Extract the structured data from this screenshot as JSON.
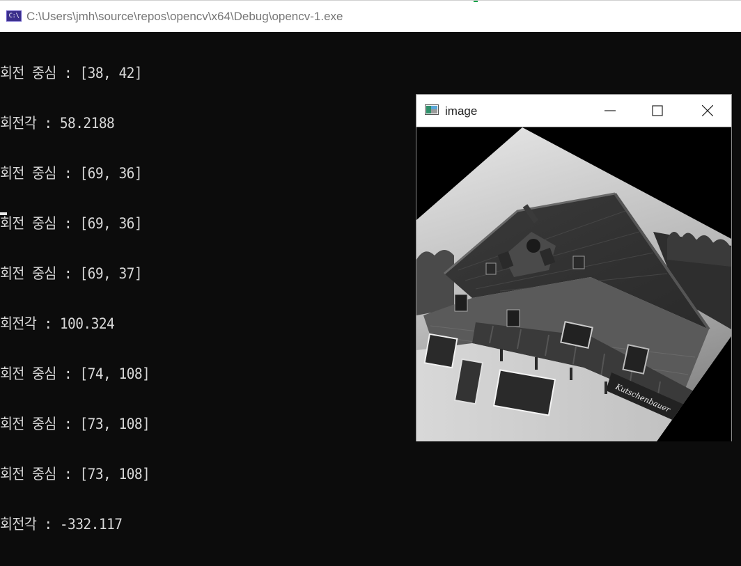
{
  "console": {
    "title": "C:\\Users\\jmh\\source\\repos\\opencv\\x64\\Debug\\opencv-1.exe",
    "icon": "C:\\",
    "icon_name": "console-app-icon",
    "lines": [
      "회전 중심 : [38, 42]",
      "회전각 : 58.2188",
      "회전 중심 : [69, 36]",
      "회전 중심 : [69, 36]",
      "회전 중심 : [69, 37]",
      "회전각 : 100.324",
      "회전 중심 : [74, 108]",
      "회전 중심 : [73, 108]",
      "회전 중심 : [73, 108]",
      "회전각 : -332.117"
    ]
  },
  "image_window": {
    "title": "image",
    "icon_name": "image-app-icon",
    "sign_text": "Kutschenbauer",
    "controls": [
      "minimize-icon",
      "maximize-icon",
      "close-icon"
    ]
  },
  "colors": {
    "console_bg": "#0c0c0c",
    "console_text": "#d8d8d8",
    "titlebar_bg": "#ffffff",
    "console_icon": "#3a2e8c"
  }
}
